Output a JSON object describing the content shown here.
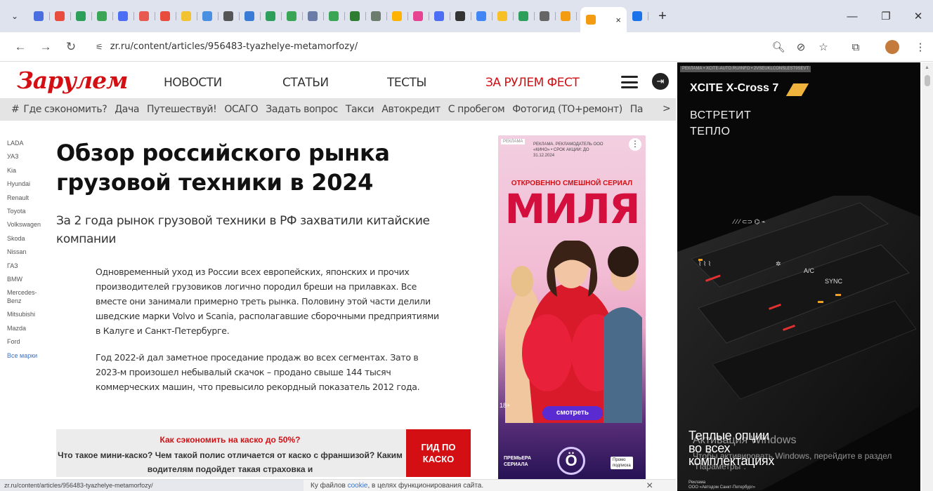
{
  "browser": {
    "url": "zr.ru/content/articles/956483-tyazhelye-metamorfozy/",
    "tab_close": "×",
    "new_tab": "+",
    "favicon_colors": [
      "#4a6ee0",
      "#e84c3d",
      "#2e9e5b",
      "#3aa655",
      "#4c6ef5",
      "#e85a4f",
      "#e74c3c",
      "#f1c232",
      "#4a90e2",
      "#555",
      "#3a7bd5",
      "#2e9e5b",
      "#3aa655",
      "#6b7ba8",
      "#3aa655",
      "#2e7d32",
      "#6d7d6d",
      "#ffb300",
      "#e84393",
      "#4c6ef5",
      "#333",
      "#4285f4",
      "#f6c026",
      "#2e9e5b",
      "#666",
      "#f39c12"
    ]
  },
  "site": {
    "logo": "Зарулем",
    "nav": [
      "НОВОСТИ",
      "СТАТЬИ",
      "ТЕСТЫ",
      "ЗА РУЛЕМ ФЕСТ"
    ],
    "subnav_hash": "#",
    "subnav": [
      "Где сэкономить?",
      "Дача",
      "Путешествуй!",
      "ОСАГО",
      "Задать вопрос",
      "Такси",
      "Автокредит",
      "С пробегом",
      "Фотогид (ТО+ремонт)",
      "Па"
    ],
    "subnav_more": ">"
  },
  "brands": [
    "LADA",
    "УАЗ",
    "Kia",
    "Hyundai",
    "Renault",
    "Toyota",
    "Volkswagen",
    "Skoda",
    "Nissan",
    "ГАЗ",
    "BMW",
    "Mercedes-Benz",
    "Mitsubishi",
    "Mazda",
    "Ford"
  ],
  "brands_all": "Все марки",
  "article": {
    "title": "Обзор российского рынка грузовой техники в 2024",
    "lead": "За 2 года рынок грузовой техники в РФ захватили китайские компании",
    "p1": "Одновременный уход из России всех европейских, японских и прочих производителей грузовиков логично породил бреши на прилавках. Все вместе они занимали примерно треть рынка. Половину этой части делили шведские марки Volvo и Scania, располагавшие сборочными предприятиями в Калуге и Санкт-Петербурге.",
    "p2": "Год 2022-й дал заметное проседание продаж во всех сегментах. Зато в 2023-м произошел небывалый скачок – продано свыше 144 тысяч коммерческих машин, что превысило рекордный показатель 2012 года."
  },
  "promo": {
    "title": "Как сэкономить на каско до 50%?",
    "text": "Что такое мини-каско? Чем такой полис отличается от каско с франшизой? Каким водителям подойдет такая страховка и",
    "button_line1": "ГИД ПО",
    "button_line2": "КАСКО"
  },
  "ad1": {
    "label": "РЕКЛАМА",
    "tiny": "РЕКЛАМА. РЕКЛАМОДАТЕЛЬ ООО «КИНО» • СРОК АКЦИИ: ДО 31.12.2024",
    "subtitle": "ОТКРОВЕННО СМЕШНОЙ СЕРИАЛ",
    "title": "МИЛЯ",
    "age": "18+",
    "watch": "смотреть",
    "premiere_line1": "ПРЕМЬЕРА",
    "premiere_line2": "СЕРИАЛА",
    "logo": "Ö",
    "sub_line1": "Промо",
    "sub_line2": "подписка",
    "dots": "⋮"
  },
  "ad2": {
    "label": "РЕКЛАМА • XCITE-AUTO.RU/INFO • 2VSEUKLCONSLEST9SEVT",
    "brand": "XCITE X-Cross 7",
    "slogan_line1": "ВСТРЕТИТ",
    "slogan_line2": "ТЕПЛО",
    "footer_line1": "Теплые опции",
    "footer_line2": "во всех",
    "footer_line3": "комплектациях",
    "legal_line1": "Реклама",
    "legal_line2": "ООО «Автодом Санкт-Петербург»"
  },
  "windows": {
    "activate_title": "Активация Windows",
    "activate_text": "Чтобы активировать Windows, перейдите в раздел \"Параметры\"."
  },
  "cookie": {
    "status": "zr.ru/content/articles/956483-tyazhelye-metamorfozy/",
    "prefix": "Ку файлов ",
    "link": "cookie",
    "suffix": ", в целях функционирования сайта.",
    "close": "×"
  }
}
